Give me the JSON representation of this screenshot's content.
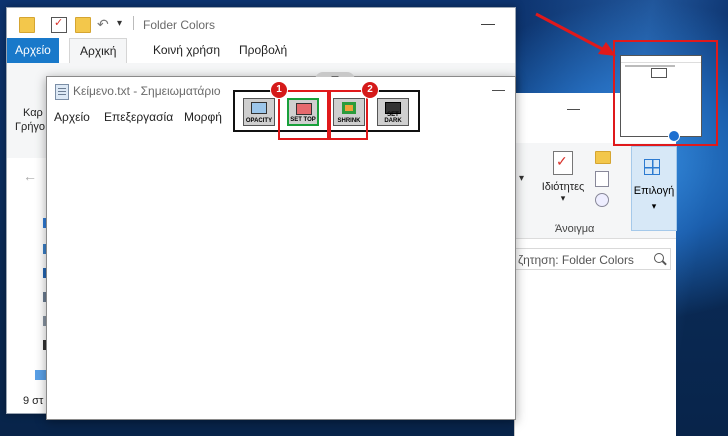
{
  "explorer": {
    "title": "Folder Colors",
    "tabs": [
      "Αρχείο",
      "Αρχική",
      "Κοινή χρήση",
      "Προβολή"
    ],
    "ribbon_left_partial": [
      "Καρ",
      "Γρήγο"
    ],
    "status_text": "9 στ",
    "window_controls": {
      "minimize": "—",
      "maximize": "☐"
    }
  },
  "explorer_right": {
    "properties_label": "Ιδιότητες",
    "open_group_label": "Άνοιγμα",
    "select_label": "Επιλογή",
    "search_placeholder": "ζητηση: Folder Colors",
    "window_controls": {
      "minimize": "—",
      "maximize": "☐"
    }
  },
  "notepad": {
    "title": "Κείμενο.txt - Σημειωματάριο",
    "menu": [
      "Αρχείο",
      "Επεξεργασία",
      "Μορφή"
    ],
    "minimize": "—"
  },
  "tools": [
    {
      "label": "OPACITY"
    },
    {
      "label": "SET TOP"
    },
    {
      "label": "SHRINK"
    },
    {
      "label": "SET DARK"
    }
  ],
  "badges": [
    "1",
    "2"
  ],
  "colors": {
    "accent": "#1979ca",
    "highlight": "#e0191b",
    "set_top_fill": "#e66a6e",
    "set_top_border": "#18a03a"
  }
}
